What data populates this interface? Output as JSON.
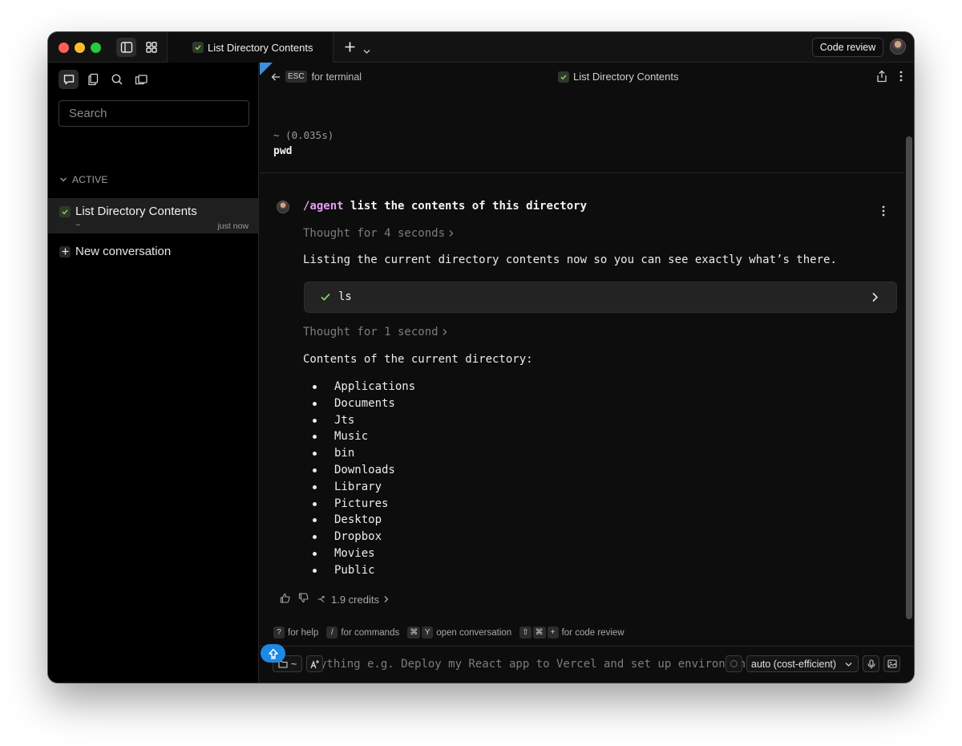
{
  "titlebar": {
    "tab_title": "List Directory Contents",
    "code_review_label": "Code review"
  },
  "sidebar": {
    "search_placeholder": "Search",
    "section_label": "ACTIVE",
    "conversations": [
      {
        "title": "List Directory Contents",
        "subtitle": "~",
        "time": "just now"
      }
    ],
    "new_conversation_label": "New conversation"
  },
  "header": {
    "esc_key": "ESC",
    "back_label": "for terminal",
    "title": "List Directory Contents"
  },
  "previous_block": {
    "meta": "~ (0.035s)",
    "command": "pwd"
  },
  "conversation": {
    "prompt_command": "/agent",
    "prompt_text": "list the contents of this directory",
    "thought1": "Thought for 4 seconds",
    "message1": "Listing the current directory contents now so you can see exactly what’s there.",
    "command_block": "ls",
    "thought2": "Thought for 1 second",
    "message2": "Contents of the current directory:",
    "directory_items": [
      "Applications",
      "Documents",
      "Jts",
      "Music",
      "bin",
      "Downloads",
      "Library",
      "Pictures",
      "Desktop",
      "Dropbox",
      "Movies",
      "Public"
    ],
    "credits": "1.9 credits"
  },
  "hints": [
    {
      "keys": [
        "?"
      ],
      "label": "for help"
    },
    {
      "keys": [
        "/"
      ],
      "label": "for commands"
    },
    {
      "keys": [
        "⌘",
        "Y"
      ],
      "label": "open conversation"
    },
    {
      "keys": [
        "⇧",
        "⌘",
        "+"
      ],
      "label": "for code review"
    }
  ],
  "input": {
    "placeholder": "Warp anything e.g. Deploy my React app to Vercel and set up environment variables"
  },
  "bottom": {
    "dir_chip": "~",
    "model_label": "auto (cost-efficient)"
  },
  "colors": {
    "accent_blue": "#1e88e5",
    "agent_command": "#e59cf4",
    "check_green": "#8bd46a"
  }
}
